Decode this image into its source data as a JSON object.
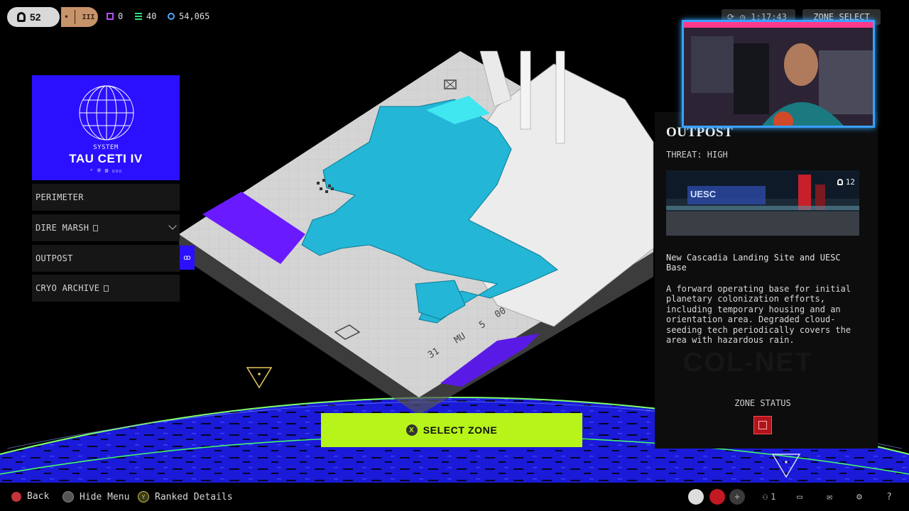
{
  "topbar": {
    "level": "52",
    "rank_icon_label": "III",
    "stats": [
      {
        "icon": "square-icon",
        "value": "0",
        "color": "#b44cff"
      },
      {
        "icon": "stack-icon",
        "value": "40",
        "color": "#2fe07a"
      },
      {
        "icon": "credits-icon",
        "value": "54,065",
        "color": "#4aa8ff"
      }
    ],
    "timer": "1:17:43",
    "zone_select": "ZONE SELECT"
  },
  "system": {
    "label": "SYSTEM",
    "name": "TAU CETI IV",
    "subtitle": "ᵒ ※ ⊠ ▫▫▫"
  },
  "zones": [
    {
      "label": "PERIMETER"
    },
    {
      "label": "DIRE MARSH"
    },
    {
      "label": "OUTPOST"
    },
    {
      "label": "CRYO ARCHIVE"
    }
  ],
  "active_zone_tab": "ꝏ",
  "info": {
    "title": "OUTPOST",
    "threat": "THREAT: HIGH",
    "preview_count": "12",
    "location": "New Cascadia Landing Site and UESC Base",
    "description": "A forward operating base for initial planetary colonization efforts, including temporary housing and an orientation area. Degraded cloud-seeding tech periodically covers the area with hazardous rain.",
    "zone_status": "ZONE STATUS",
    "watermark": "COL-NET"
  },
  "select_zone": {
    "button_glyph": "X",
    "label": "SELECT ZONE"
  },
  "bottombar": {
    "back": "Back",
    "hide_menu": "Hide Menu",
    "ranked_details": "Ranked Details",
    "party_count": "1"
  },
  "map_labels": {
    "marker_a": "31",
    "marker_b": "MU",
    "marker_c": "5",
    "marker_d": "00"
  },
  "colors": {
    "accent_blue": "#2b10ff",
    "accent_lime": "#b6f41a",
    "city_cyan": "#23b6d6",
    "status_red": "#b0141c"
  }
}
